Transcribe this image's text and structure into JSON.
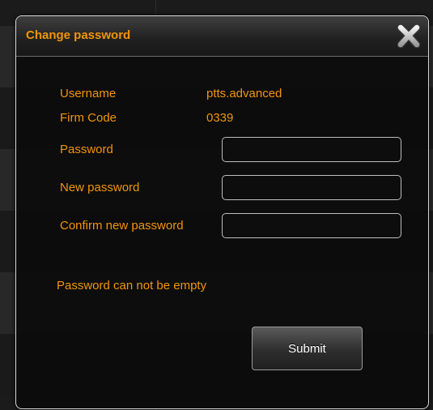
{
  "dialog": {
    "title": "Change password",
    "close_icon": "close-icon"
  },
  "info": {
    "username_label": "Username",
    "username_value": "ptts.advanced",
    "firm_code_label": "Firm Code",
    "firm_code_value": "0339"
  },
  "form": {
    "password_label": "Password",
    "password_value": "",
    "new_password_label": "New password",
    "new_password_value": "",
    "confirm_password_label": "Confirm new password",
    "confirm_password_value": ""
  },
  "error": {
    "message": "Password can not be empty"
  },
  "actions": {
    "submit_label": "Submit"
  },
  "colors": {
    "accent": "#f0950b",
    "dialog_bg": "#0c0c0c",
    "border": "#d7d7d7"
  }
}
